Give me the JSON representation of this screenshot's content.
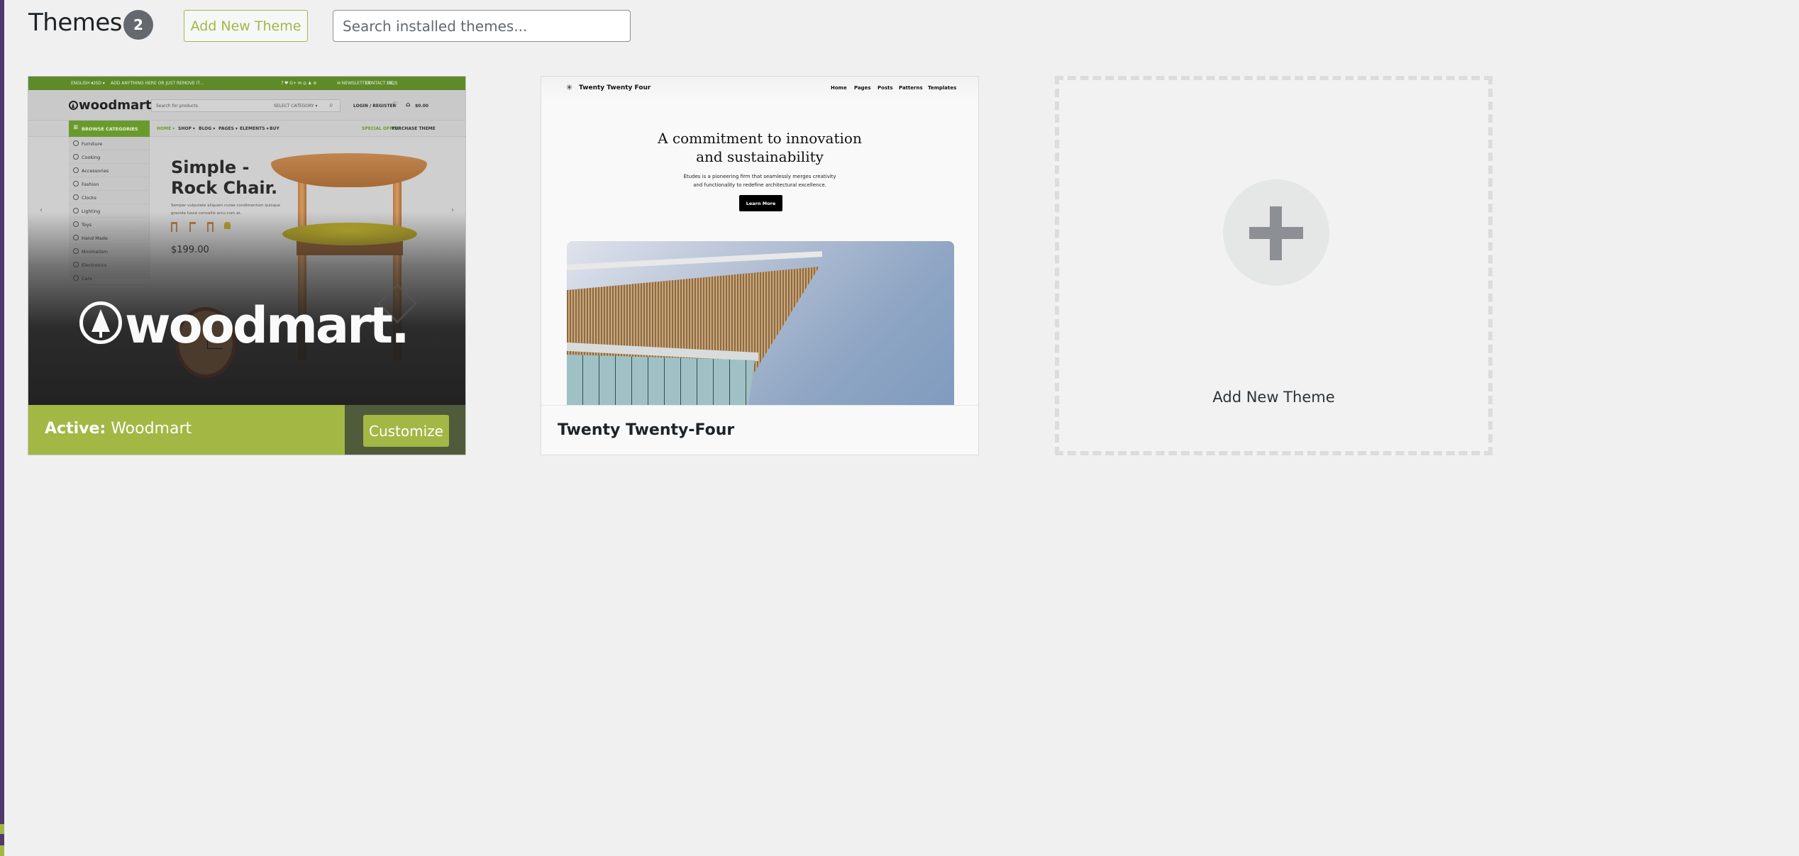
{
  "header": {
    "title": "Themes",
    "count": "2",
    "add_new_label": "Add New Theme",
    "search_placeholder": "Search installed themes..."
  },
  "colors": {
    "accent": "#a3b745",
    "accent_dark": "#4f5b3a",
    "admin_menu": "#4f3a6c",
    "badge": "#646970",
    "page_bg": "#f0f0f1"
  },
  "themes": [
    {
      "name": "Woodmart",
      "active": true,
      "active_prefix": "Active:",
      "customize_label": "Customize",
      "preview": {
        "topbar": [
          "ENGLISH ▾",
          "USD ▾",
          "ADD ANYTHING HERE OR JUST REMOVE IT...",
          "f  ♥  G+  ✉  ◎  ♟  ⊚",
          "✉ NEWSLETTER",
          "CONTACT US",
          "FAQS"
        ],
        "logo": "woodmart.",
        "search_placeholder": "Search for products",
        "select_category": "SELECT CATEGORY ▾",
        "login": "LOGIN / REGISTER",
        "cart": "$0.00",
        "browse_label": "BROWSE CATEGORIES",
        "nav": [
          "HOME ▾",
          "SHOP ▾",
          "BLOG ▾",
          "PAGES ▾",
          "ELEMENTS ▾",
          "BUY"
        ],
        "nav_right": [
          "SPECIAL OFFER",
          "PURCHASE THEME"
        ],
        "categories": [
          "Furniture",
          "Cooking",
          "Accessories",
          "Fashion",
          "Clocks",
          "Lighting",
          "Toys",
          "Hand Made",
          "Minimalism",
          "Electronics",
          "Cars"
        ],
        "hero_title_1": "Simple -",
        "hero_title_2": "Rock Chair.",
        "hero_desc": "Semper vulputate aliquam curae condimentum quisque gravida fusce convallis arcu cum at.",
        "price": "$199.00",
        "big_logo": "woodmart."
      }
    },
    {
      "name": "Twenty Twenty-Four",
      "active": false,
      "preview": {
        "site_title": "Twenty Twenty Four",
        "nav": [
          "Home",
          "Pages",
          "Posts",
          "Patterns",
          "Templates"
        ],
        "heading_1": "A commitment to innovation",
        "heading_2": "and sustainability",
        "desc_1": "Études is a pioneering firm that seamlessly merges creativity",
        "desc_2": "and functionality to redefine architectural excellence.",
        "button": "Learn More"
      }
    }
  ],
  "add_new_card": {
    "label": "Add New Theme",
    "icon": "plus-icon"
  }
}
